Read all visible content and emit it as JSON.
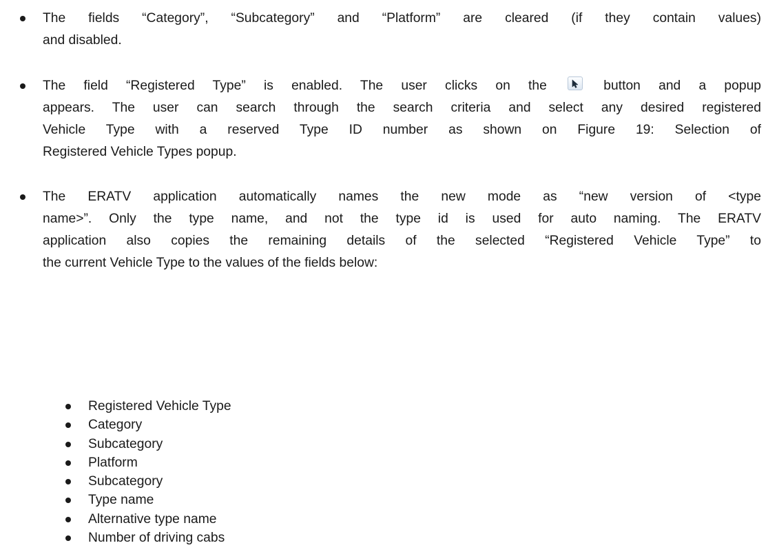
{
  "bullets": [
    {
      "lines": [
        "The fields “Category”, “Subcategory” and “Platform” are cleared (if they contain values)",
        "and disabled."
      ]
    },
    {
      "line1_before": "The field “Registered Type” is enabled. The user clicks on the",
      "line1_after": "button and a popup",
      "button_icon": "cursor-arrow-icon",
      "lines": [
        "appears. The user can search through the search criteria and select any desired registered",
        "Vehicle Type with a reserved Type ID number as shown on Figure 19: Selection of",
        "Registered Vehicle Types popup."
      ]
    },
    {
      "lines": [
        "The ERATV application automatically names the new mode as “new version of <type",
        "name>”. Only the type name, and not the type id is used for auto naming. The ERATV",
        "application also copies the remaining details of the selected “Registered Vehicle Type” to",
        "the current Vehicle Type to the values of the fields below:"
      ]
    }
  ],
  "fields": [
    "Registered Vehicle Type",
    "Category",
    "Subcategory",
    "Platform",
    "Subcategory",
    "Type name",
    "Alternative type name",
    "Number of driving cabs"
  ]
}
